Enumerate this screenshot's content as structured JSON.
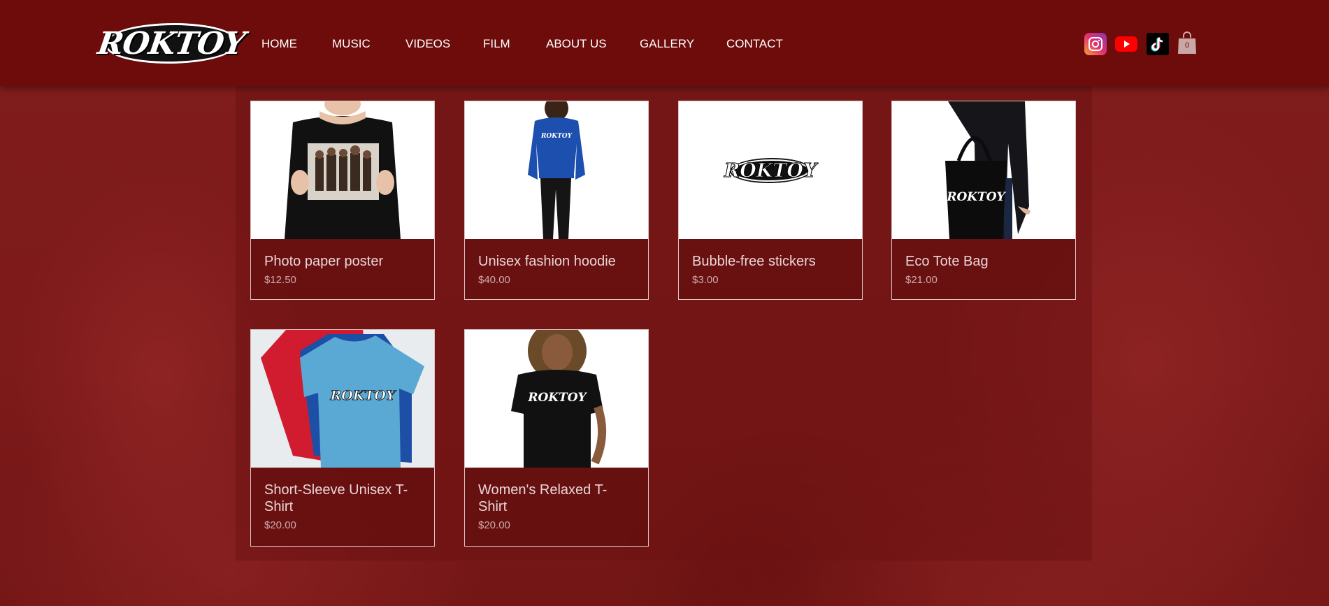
{
  "brand": {
    "logo_text": "ROKTOY"
  },
  "nav": {
    "items": [
      "HOME",
      "MUSIC",
      "VIDEOS",
      "FILM",
      "ABOUT US",
      "GALLERY",
      "CONTACT"
    ]
  },
  "social": {
    "icons": [
      "instagram-icon",
      "youtube-icon",
      "tiktok-icon"
    ]
  },
  "cart": {
    "count": "0"
  },
  "colors": {
    "header": "#6e0b0b",
    "background": "#7a1a1a",
    "card_border": "#ffffff"
  },
  "products": [
    {
      "name": "Photo paper poster",
      "price": "$12.50"
    },
    {
      "name": "Unisex fashion hoodie",
      "price": "$40.00"
    },
    {
      "name": "Bubble-free stickers",
      "price": "$3.00"
    },
    {
      "name": "Eco Tote Bag",
      "price": "$21.00"
    },
    {
      "name": "Short-Sleeve Unisex T-Shirt",
      "price": "$20.00"
    },
    {
      "name": "Women's Relaxed T-Shirt",
      "price": "$20.00"
    }
  ]
}
